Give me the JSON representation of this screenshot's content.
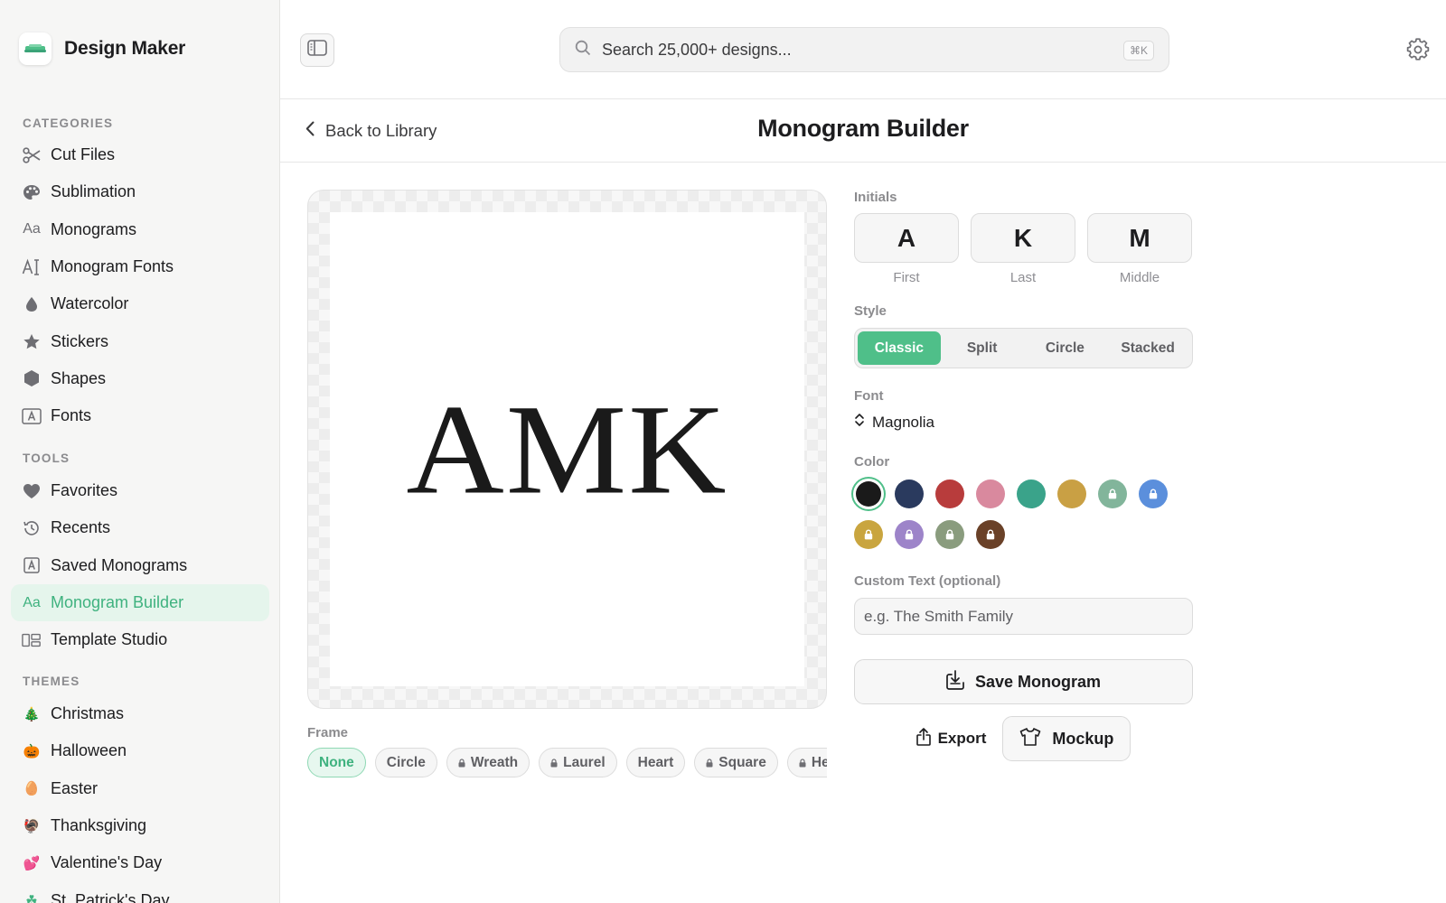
{
  "app": {
    "name": "Design Maker",
    "logo_icon": "design-maker-logo-icon"
  },
  "sidebar": {
    "categories_label": "CATEGORIES",
    "categories": [
      {
        "label": "Cut Files",
        "icon": "scissors-icon"
      },
      {
        "label": "Sublimation",
        "icon": "palette-icon"
      },
      {
        "label": "Monograms",
        "icon": "text-aa-icon"
      },
      {
        "label": "Monogram Fonts",
        "icon": "text-cursor-icon"
      },
      {
        "label": "Watercolor",
        "icon": "droplet-icon"
      },
      {
        "label": "Stickers",
        "icon": "star-icon"
      },
      {
        "label": "Shapes",
        "icon": "hexagon-icon"
      },
      {
        "label": "Fonts",
        "icon": "font-box-icon"
      }
    ],
    "tools_label": "TOOLS",
    "tools": [
      {
        "label": "Favorites",
        "icon": "heart-icon"
      },
      {
        "label": "Recents",
        "icon": "history-icon"
      },
      {
        "label": "Saved Monograms",
        "icon": "saved-monogram-icon"
      },
      {
        "label": "Monogram Builder",
        "icon": "text-aa-icon",
        "active": true
      },
      {
        "label": "Template Studio",
        "icon": "template-icon"
      }
    ],
    "themes_label": "THEMES",
    "themes": [
      {
        "label": "Christmas",
        "glyph": "🎄"
      },
      {
        "label": "Halloween",
        "glyph": "🎃"
      },
      {
        "label": "Easter",
        "glyph": "🥚"
      },
      {
        "label": "Thanksgiving",
        "glyph": "🦃"
      },
      {
        "label": "Valentine's Day",
        "glyph": "💕"
      },
      {
        "label": "St. Patrick's Day",
        "glyph": "☘"
      }
    ]
  },
  "topbar": {
    "search_placeholder": "Search 25,000+ designs...",
    "shortcut": "⌘K"
  },
  "header": {
    "back_label": "Back to Library",
    "title": "Monogram Builder"
  },
  "preview": {
    "monogram_text": "AMK"
  },
  "frame": {
    "label": "Frame",
    "options": [
      {
        "label": "None",
        "locked": false,
        "active": true
      },
      {
        "label": "Circle",
        "locked": false
      },
      {
        "label": "Wreath",
        "locked": true
      },
      {
        "label": "Laurel",
        "locked": true
      },
      {
        "label": "Heart",
        "locked": false
      },
      {
        "label": "Square",
        "locked": true
      },
      {
        "label": "He",
        "locked": true
      }
    ]
  },
  "controls": {
    "initials_label": "Initials",
    "initials": [
      {
        "value": "A",
        "caption": "First"
      },
      {
        "value": "K",
        "caption": "Last"
      },
      {
        "value": "M",
        "caption": "Middle"
      }
    ],
    "style_label": "Style",
    "styles": [
      {
        "label": "Classic",
        "active": true
      },
      {
        "label": "Split"
      },
      {
        "label": "Circle"
      },
      {
        "label": "Stacked"
      }
    ],
    "font_label": "Font",
    "font_value": "Magnolia",
    "color_label": "Color",
    "colors": [
      {
        "hex": "#1a1a1a",
        "selected": true,
        "locked": false
      },
      {
        "hex": "#2a3a5e",
        "locked": false
      },
      {
        "hex": "#b83c3c",
        "locked": false
      },
      {
        "hex": "#d9899e",
        "locked": false
      },
      {
        "hex": "#3aa38a",
        "locked": false
      },
      {
        "hex": "#c9a044",
        "locked": false
      },
      {
        "hex": "#82b59b",
        "locked": true
      },
      {
        "hex": "#5b8fdc",
        "locked": true
      },
      {
        "hex": "#c9a53f",
        "locked": true
      },
      {
        "hex": "#9d84c9",
        "locked": true
      },
      {
        "hex": "#8a9c7e",
        "locked": true
      },
      {
        "hex": "#6a4128",
        "locked": true
      }
    ],
    "custom_text_label": "Custom Text (optional)",
    "custom_text_placeholder": "e.g. The Smith Family",
    "save_label": "Save Monogram",
    "export_label": "Export",
    "mockup_label": "Mockup"
  },
  "accent_color": "#4fbf89"
}
